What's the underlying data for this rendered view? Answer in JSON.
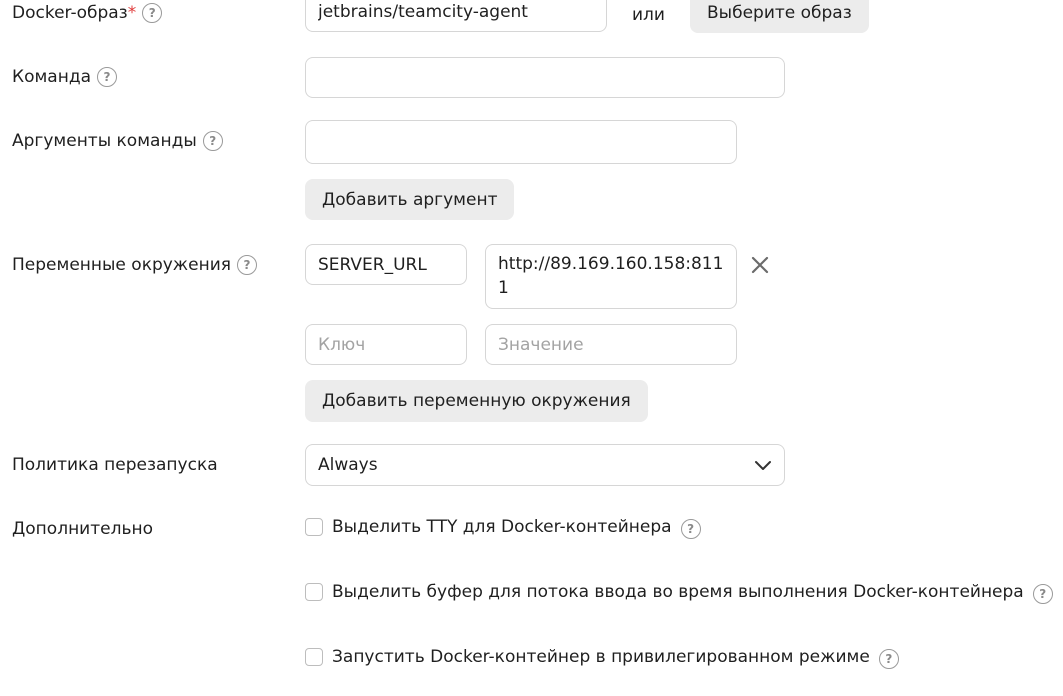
{
  "docker_image": {
    "label": "Docker-образ",
    "required_mark": "*",
    "value": "jetbrains/teamcity-agent",
    "or_text": "или",
    "choose_button": "Выберите образ"
  },
  "command": {
    "label": "Команда",
    "value": ""
  },
  "command_args": {
    "label": "Аргументы команды",
    "value": "",
    "add_button": "Добавить аргумент"
  },
  "env_vars": {
    "label": "Переменные окружения",
    "entries": [
      {
        "key": "SERVER_URL",
        "value": "http://89.169.160.158:8111"
      }
    ],
    "key_placeholder": "Ключ",
    "value_placeholder": "Значение",
    "add_button": "Добавить переменную окружения"
  },
  "restart_policy": {
    "label": "Политика перезапуска",
    "selected": "Always"
  },
  "additional": {
    "label": "Дополнительно",
    "options": [
      {
        "label": "Выделить TTY для Docker-контейнера",
        "checked": false
      },
      {
        "label": "Выделить буфер для потока ввода во время выполнения Docker-контейнера",
        "checked": false
      },
      {
        "label": "Запустить Docker-контейнер в привилегированном режиме",
        "checked": false
      }
    ]
  },
  "icons": {
    "help": "question-circle-icon",
    "remove": "close-icon",
    "dropdown": "chevron-down-icon"
  },
  "help_glyph": "?",
  "colors": {
    "required": "#e03b3b",
    "button_bg": "#ececec",
    "border": "#d6d6d6"
  }
}
